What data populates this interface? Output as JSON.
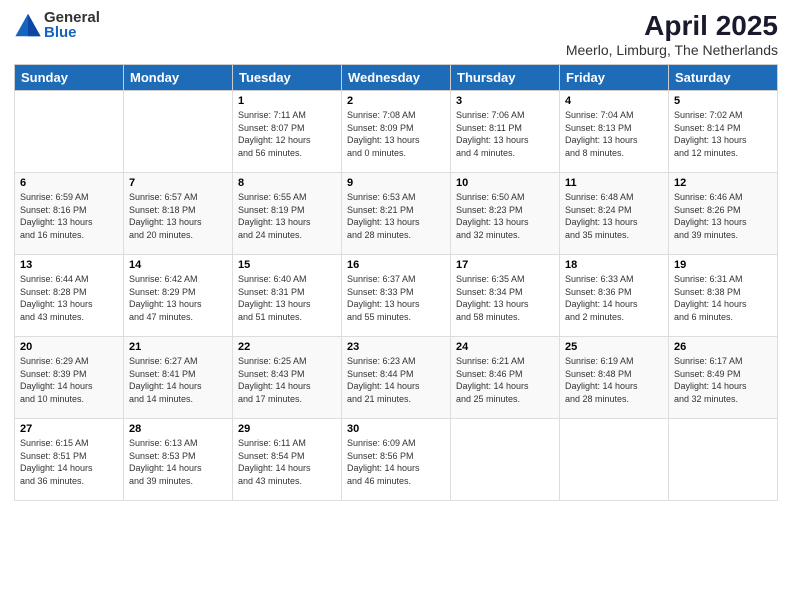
{
  "logo": {
    "general": "General",
    "blue": "Blue"
  },
  "header": {
    "title": "April 2025",
    "subtitle": "Meerlo, Limburg, The Netherlands"
  },
  "days_of_week": [
    "Sunday",
    "Monday",
    "Tuesday",
    "Wednesday",
    "Thursday",
    "Friday",
    "Saturday"
  ],
  "weeks": [
    [
      {
        "day": "",
        "info": ""
      },
      {
        "day": "",
        "info": ""
      },
      {
        "day": "1",
        "info": "Sunrise: 7:11 AM\nSunset: 8:07 PM\nDaylight: 12 hours\nand 56 minutes."
      },
      {
        "day": "2",
        "info": "Sunrise: 7:08 AM\nSunset: 8:09 PM\nDaylight: 13 hours\nand 0 minutes."
      },
      {
        "day": "3",
        "info": "Sunrise: 7:06 AM\nSunset: 8:11 PM\nDaylight: 13 hours\nand 4 minutes."
      },
      {
        "day": "4",
        "info": "Sunrise: 7:04 AM\nSunset: 8:13 PM\nDaylight: 13 hours\nand 8 minutes."
      },
      {
        "day": "5",
        "info": "Sunrise: 7:02 AM\nSunset: 8:14 PM\nDaylight: 13 hours\nand 12 minutes."
      }
    ],
    [
      {
        "day": "6",
        "info": "Sunrise: 6:59 AM\nSunset: 8:16 PM\nDaylight: 13 hours\nand 16 minutes."
      },
      {
        "day": "7",
        "info": "Sunrise: 6:57 AM\nSunset: 8:18 PM\nDaylight: 13 hours\nand 20 minutes."
      },
      {
        "day": "8",
        "info": "Sunrise: 6:55 AM\nSunset: 8:19 PM\nDaylight: 13 hours\nand 24 minutes."
      },
      {
        "day": "9",
        "info": "Sunrise: 6:53 AM\nSunset: 8:21 PM\nDaylight: 13 hours\nand 28 minutes."
      },
      {
        "day": "10",
        "info": "Sunrise: 6:50 AM\nSunset: 8:23 PM\nDaylight: 13 hours\nand 32 minutes."
      },
      {
        "day": "11",
        "info": "Sunrise: 6:48 AM\nSunset: 8:24 PM\nDaylight: 13 hours\nand 35 minutes."
      },
      {
        "day": "12",
        "info": "Sunrise: 6:46 AM\nSunset: 8:26 PM\nDaylight: 13 hours\nand 39 minutes."
      }
    ],
    [
      {
        "day": "13",
        "info": "Sunrise: 6:44 AM\nSunset: 8:28 PM\nDaylight: 13 hours\nand 43 minutes."
      },
      {
        "day": "14",
        "info": "Sunrise: 6:42 AM\nSunset: 8:29 PM\nDaylight: 13 hours\nand 47 minutes."
      },
      {
        "day": "15",
        "info": "Sunrise: 6:40 AM\nSunset: 8:31 PM\nDaylight: 13 hours\nand 51 minutes."
      },
      {
        "day": "16",
        "info": "Sunrise: 6:37 AM\nSunset: 8:33 PM\nDaylight: 13 hours\nand 55 minutes."
      },
      {
        "day": "17",
        "info": "Sunrise: 6:35 AM\nSunset: 8:34 PM\nDaylight: 13 hours\nand 58 minutes."
      },
      {
        "day": "18",
        "info": "Sunrise: 6:33 AM\nSunset: 8:36 PM\nDaylight: 14 hours\nand 2 minutes."
      },
      {
        "day": "19",
        "info": "Sunrise: 6:31 AM\nSunset: 8:38 PM\nDaylight: 14 hours\nand 6 minutes."
      }
    ],
    [
      {
        "day": "20",
        "info": "Sunrise: 6:29 AM\nSunset: 8:39 PM\nDaylight: 14 hours\nand 10 minutes."
      },
      {
        "day": "21",
        "info": "Sunrise: 6:27 AM\nSunset: 8:41 PM\nDaylight: 14 hours\nand 14 minutes."
      },
      {
        "day": "22",
        "info": "Sunrise: 6:25 AM\nSunset: 8:43 PM\nDaylight: 14 hours\nand 17 minutes."
      },
      {
        "day": "23",
        "info": "Sunrise: 6:23 AM\nSunset: 8:44 PM\nDaylight: 14 hours\nand 21 minutes."
      },
      {
        "day": "24",
        "info": "Sunrise: 6:21 AM\nSunset: 8:46 PM\nDaylight: 14 hours\nand 25 minutes."
      },
      {
        "day": "25",
        "info": "Sunrise: 6:19 AM\nSunset: 8:48 PM\nDaylight: 14 hours\nand 28 minutes."
      },
      {
        "day": "26",
        "info": "Sunrise: 6:17 AM\nSunset: 8:49 PM\nDaylight: 14 hours\nand 32 minutes."
      }
    ],
    [
      {
        "day": "27",
        "info": "Sunrise: 6:15 AM\nSunset: 8:51 PM\nDaylight: 14 hours\nand 36 minutes."
      },
      {
        "day": "28",
        "info": "Sunrise: 6:13 AM\nSunset: 8:53 PM\nDaylight: 14 hours\nand 39 minutes."
      },
      {
        "day": "29",
        "info": "Sunrise: 6:11 AM\nSunset: 8:54 PM\nDaylight: 14 hours\nand 43 minutes."
      },
      {
        "day": "30",
        "info": "Sunrise: 6:09 AM\nSunset: 8:56 PM\nDaylight: 14 hours\nand 46 minutes."
      },
      {
        "day": "",
        "info": ""
      },
      {
        "day": "",
        "info": ""
      },
      {
        "day": "",
        "info": ""
      }
    ]
  ]
}
